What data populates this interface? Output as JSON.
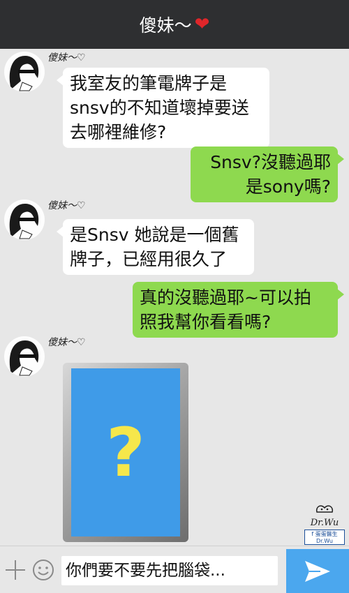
{
  "header": {
    "title": "傻妹～",
    "heart": "❤"
  },
  "messages": [
    {
      "sender": "傻妹～♡",
      "text": [
        "我室友的筆電牌子是",
        "snsv的不知道壞掉要送",
        "去哪裡維修?"
      ]
    },
    {
      "text": [
        "Snsv?沒聽過耶",
        "是sony嗎?"
      ]
    },
    {
      "sender": "傻妹～♡",
      "text": [
        "是Snsv 她說是一個舊",
        "牌子，已經用很久了"
      ]
    },
    {
      "text": [
        "真的沒聽過耶~可以拍",
        "照我幫你看看嗎?"
      ]
    },
    {
      "sender": "傻妹～♡",
      "photo_symbol": "?"
    }
  ],
  "watermark": {
    "signature": "Dr.Wu",
    "facebook": "f 蛋蛋醫生Dr.Wu"
  },
  "input": {
    "value": "你們要不要先把腦袋..."
  },
  "colors": {
    "header_bg": "#2e2f31",
    "chat_bg": "#e7e7e7",
    "incoming_bubble": "#ffffff",
    "outgoing_bubble": "#8ed94f",
    "send_button": "#4ba7ee",
    "heart": "#e0262a",
    "photo_screen": "#3f9be8",
    "question_mark": "#f6e74b"
  },
  "icons": [
    "plus-icon",
    "smile-icon",
    "send-icon",
    "heart-icon"
  ]
}
